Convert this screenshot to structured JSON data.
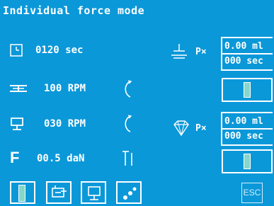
{
  "title": "Individual force mode",
  "rows": {
    "time": {
      "value": "0120 sec",
      "icon": "clock-icon"
    },
    "speed1": {
      "value": "100 RPM",
      "icon": "spindle-icon",
      "dir_icon": "rotation-icon"
    },
    "speed2": {
      "value": "030 RPM",
      "icon": "spindle-stand-icon",
      "dir_icon": "rotation-icon"
    },
    "force": {
      "icon_text": "F",
      "value": "00.5 daN",
      "trend_icon": "force-profile-icon"
    }
  },
  "right_panel": {
    "p1": {
      "label": "P×",
      "icon": "press-icon",
      "volume": "0.00 ml",
      "time": "000 sec"
    },
    "p2": {
      "label": "P×",
      "icon": "diamond-icon",
      "volume": "0.00 ml",
      "time": "000 sec"
    }
  },
  "bottom_buttons": [
    {
      "icon": "toggle-bar-icon"
    },
    {
      "icon": "mixer-icon"
    },
    {
      "icon": "stand-icon"
    },
    {
      "icon": "droplets-icon"
    }
  ],
  "esc_label": "ESC",
  "colors": {
    "background": "#0a98d9",
    "foreground": "#ffffff",
    "indicator": "#86d6c9"
  }
}
